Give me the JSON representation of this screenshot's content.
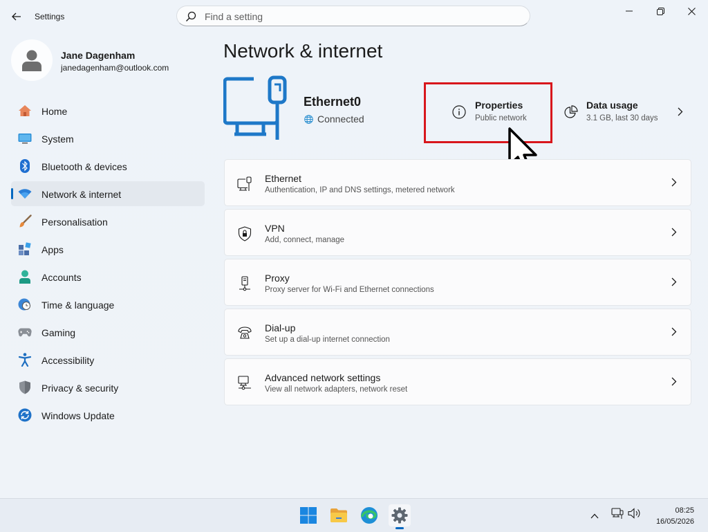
{
  "window": {
    "title": "Settings",
    "search_placeholder": "Find a setting"
  },
  "user": {
    "name": "Jane Dagenham",
    "email": "janedagenham@outlook.com"
  },
  "nav": {
    "items": [
      {
        "label": "Home",
        "icon": "home-icon",
        "active": false
      },
      {
        "label": "System",
        "icon": "system-icon",
        "active": false
      },
      {
        "label": "Bluetooth & devices",
        "icon": "bluetooth-icon",
        "active": false
      },
      {
        "label": "Network & internet",
        "icon": "wifi-icon",
        "active": true
      },
      {
        "label": "Personalisation",
        "icon": "brush-icon",
        "active": false
      },
      {
        "label": "Apps",
        "icon": "apps-icon",
        "active": false
      },
      {
        "label": "Accounts",
        "icon": "account-icon",
        "active": false
      },
      {
        "label": "Time & language",
        "icon": "clock-globe-icon",
        "active": false
      },
      {
        "label": "Gaming",
        "icon": "gamepad-icon",
        "active": false
      },
      {
        "label": "Accessibility",
        "icon": "accessibility-icon",
        "active": false
      },
      {
        "label": "Privacy & security",
        "icon": "shield-icon",
        "active": false
      },
      {
        "label": "Windows Update",
        "icon": "update-icon",
        "active": false
      }
    ]
  },
  "main": {
    "title": "Network & internet",
    "adapter": {
      "name": "Ethernet0",
      "status": "Connected"
    },
    "properties": {
      "title": "Properties",
      "subtitle": "Public network"
    },
    "data_usage": {
      "title": "Data usage",
      "subtitle": "3.1 GB, last 30 days"
    },
    "cards": [
      {
        "title": "Ethernet",
        "subtitle": "Authentication, IP and DNS settings, metered network",
        "icon": "ethernet-icon"
      },
      {
        "title": "VPN",
        "subtitle": "Add, connect, manage",
        "icon": "vpn-shield-icon"
      },
      {
        "title": "Proxy",
        "subtitle": "Proxy server for Wi-Fi and Ethernet connections",
        "icon": "proxy-icon"
      },
      {
        "title": "Dial-up",
        "subtitle": "Set up a dial-up internet connection",
        "icon": "dialup-icon"
      },
      {
        "title": "Advanced network settings",
        "subtitle": "View all network adapters, network reset",
        "icon": "advanced-network-icon"
      }
    ]
  },
  "taskbar": {
    "time": "08:25",
    "date": "16/05/2026"
  },
  "colors": {
    "accent": "#0067c0",
    "highlight_box": "#d8161c"
  }
}
